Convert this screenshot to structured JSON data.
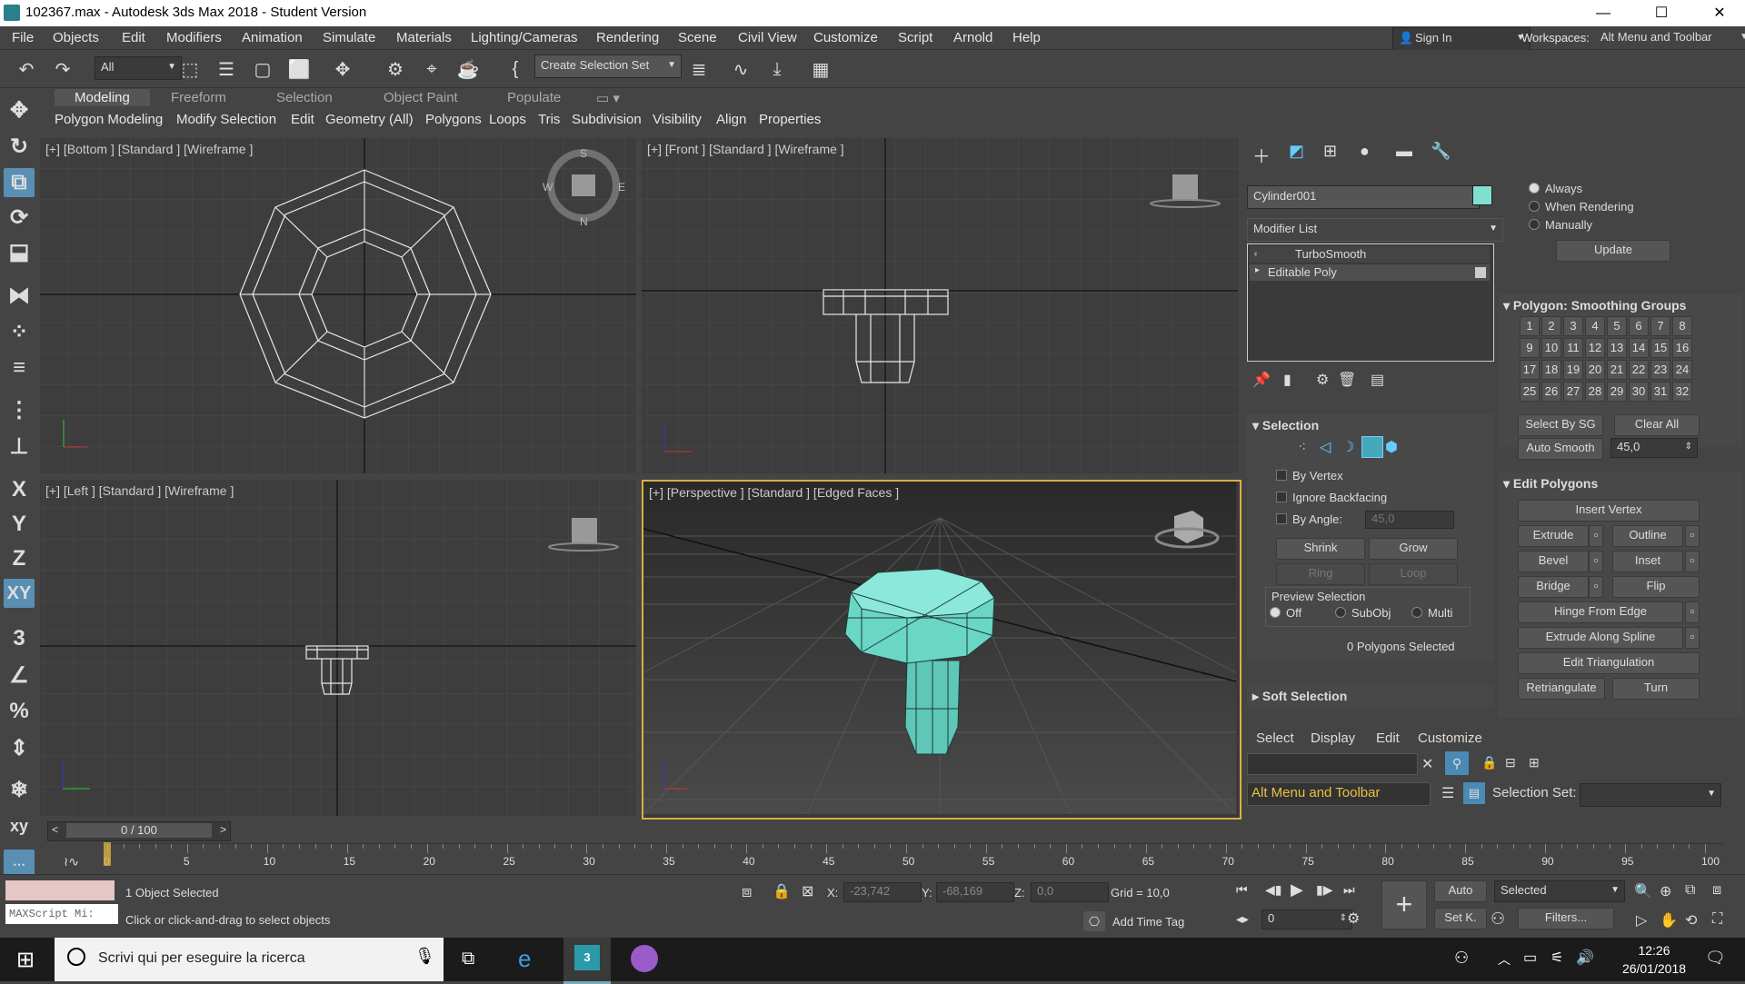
{
  "window": {
    "title": "102367.max - Autodesk 3ds Max 2018 - Student Version",
    "minimize": "—",
    "maximize": "☐",
    "close": "✕"
  },
  "menu": [
    "File",
    "Objects",
    "Edit",
    "Modifiers",
    "Animation",
    "Simulate",
    "Materials",
    "Lighting/Cameras",
    "Rendering",
    "Scene",
    "Civil View",
    "Customize",
    "Script",
    "Arnold",
    "Help"
  ],
  "signin": {
    "label": "Sign In"
  },
  "workspaces": {
    "label": "Workspaces:",
    "value": "Alt Menu and Toolbar"
  },
  "toolbar": {
    "filter": "All",
    "selection_set": "Create Selection Set"
  },
  "ribbon": {
    "tabs": [
      "Modeling",
      "Freeform",
      "Selection",
      "Object Paint",
      "Populate"
    ],
    "subtabs": [
      "Polygon Modeling",
      "Modify Selection",
      "Edit",
      "Geometry (All)",
      "Polygons",
      "Loops",
      "Tris",
      "Subdivision",
      "Visibility",
      "Align",
      "Properties"
    ]
  },
  "leftbar": {
    "x": "X",
    "y": "Y",
    "z": "Z",
    "xy": "XY"
  },
  "viewports": {
    "bottom": "[+] [Bottom ] [Standard ] [Wireframe ]",
    "front": "[+] [Front ] [Standard ] [Wireframe ]",
    "left": "[+] [Left ] [Standard ] [Wireframe ]",
    "perspective": "[+] [Perspective ] [Standard ] [Edged Faces ]",
    "compass": {
      "s": "S",
      "n": "N",
      "e": "E",
      "w": "W"
    }
  },
  "panel": {
    "object_name": "Cylinder001",
    "object_color": "#7fe0d0",
    "modifier_list": "Modifier List",
    "stack": [
      "TurboSmooth",
      "Editable Poly"
    ],
    "update_radios": [
      "Always",
      "When Rendering",
      "Manually"
    ],
    "update_btn": "Update",
    "smoothing_groups": {
      "title": "Polygon: Smoothing Groups",
      "numbers": [
        "1",
        "2",
        "3",
        "4",
        "5",
        "6",
        "7",
        "8",
        "9",
        "10",
        "11",
        "12",
        "13",
        "14",
        "15",
        "16",
        "17",
        "18",
        "19",
        "20",
        "21",
        "22",
        "23",
        "24",
        "25",
        "26",
        "27",
        "28",
        "29",
        "30",
        "31",
        "32"
      ],
      "select_by_sg": "Select By SG",
      "clear_all": "Clear All",
      "auto_smooth": "Auto Smooth",
      "auto_smooth_value": "45,0"
    },
    "edit_polygons": {
      "title": "Edit Polygons",
      "insert_vertex": "Insert Vertex",
      "extrude": "Extrude",
      "outline": "Outline",
      "bevel": "Bevel",
      "inset": "Inset",
      "bridge": "Bridge",
      "flip": "Flip",
      "hinge": "Hinge From Edge",
      "extrude_spline": "Extrude Along Spline",
      "edit_tri": "Edit Triangulation",
      "retriangulate": "Retriangulate",
      "turn": "Turn"
    },
    "selection": {
      "title": "Selection",
      "by_vertex": "By Vertex",
      "ignore_backfacing": "Ignore Backfacing",
      "by_angle": "By Angle:",
      "by_angle_value": "45,0",
      "shrink": "Shrink",
      "grow": "Grow",
      "ring": "Ring",
      "loop": "Loop",
      "preview": "Preview Selection",
      "preview_opts": [
        "Off",
        "SubObj",
        "Multi"
      ],
      "count": "0 Polygons Selected"
    },
    "soft_selection": "Soft Selection"
  },
  "scene_explorer": {
    "menu": [
      "Select",
      "Display",
      "Edit",
      "Customize"
    ],
    "workspace": "Alt Menu and Toolbar",
    "selection_set": "Selection Set:"
  },
  "timeline": {
    "frame": "0 / 100",
    "ticks": [
      "0",
      "5",
      "10",
      "15",
      "20",
      "25",
      "30",
      "35",
      "40",
      "45",
      "50",
      "55",
      "60",
      "65",
      "70",
      "75",
      "80",
      "85",
      "90",
      "95",
      "100"
    ]
  },
  "status": {
    "maxscript": "MAXScript Mi:",
    "objects_selected": "1 Object Selected",
    "prompt": "Click or click-and-drag to select objects",
    "x_label": "X:",
    "x_value": "-23,742",
    "y_label": "Y:",
    "y_value": "-68,169",
    "z_label": "Z:",
    "z_value": "0,0",
    "grid": "Grid = 10,0",
    "add_time_tag": "Add Time Tag",
    "auto": "Auto",
    "set_k": "Set K.",
    "key_mode": "Selected",
    "filters": "Filters...",
    "frame_field": "0"
  },
  "taskbar": {
    "search_placeholder": "Scrivi qui per eseguire la ricerca",
    "time": "12:26",
    "date": "26/01/2018"
  }
}
